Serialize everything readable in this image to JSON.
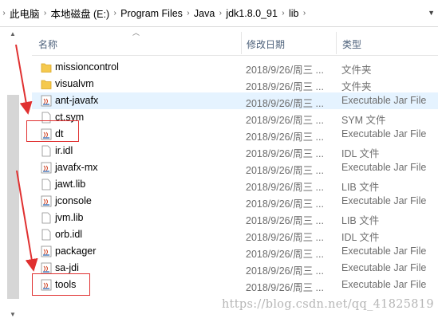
{
  "breadcrumb": {
    "segments": [
      "此电脑",
      "本地磁盘 (E:)",
      "Program Files",
      "Java",
      "jdk1.8.0_91",
      "lib"
    ]
  },
  "columns": {
    "name": "名称",
    "date": "修改日期",
    "type": "类型"
  },
  "files": [
    {
      "name": "missioncontrol",
      "date": "2018/9/26/周三 ...",
      "type": "文件夹",
      "icon": "folder-icon"
    },
    {
      "name": "visualvm",
      "date": "2018/9/26/周三 ...",
      "type": "文件夹",
      "icon": "folder-icon"
    },
    {
      "name": "ant-javafx",
      "date": "2018/9/26/周三 ...",
      "type": "Executable Jar File",
      "icon": "jar-icon"
    },
    {
      "name": "ct.sym",
      "date": "2018/9/26/周三 ...",
      "type": "SYM 文件",
      "icon": "file-icon"
    },
    {
      "name": "dt",
      "date": "2018/9/26/周三 ...",
      "type": "Executable Jar File",
      "icon": "jar-icon"
    },
    {
      "name": "ir.idl",
      "date": "2018/9/26/周三 ...",
      "type": "IDL 文件",
      "icon": "file-icon"
    },
    {
      "name": "javafx-mx",
      "date": "2018/9/26/周三 ...",
      "type": "Executable Jar File",
      "icon": "jar-icon"
    },
    {
      "name": "jawt.lib",
      "date": "2018/9/26/周三 ...",
      "type": "LIB 文件",
      "icon": "file-icon"
    },
    {
      "name": "jconsole",
      "date": "2018/9/26/周三 ...",
      "type": "Executable Jar File",
      "icon": "jar-icon"
    },
    {
      "name": "jvm.lib",
      "date": "2018/9/26/周三 ...",
      "type": "LIB 文件",
      "icon": "file-icon"
    },
    {
      "name": "orb.idl",
      "date": "2018/9/26/周三 ...",
      "type": "IDL 文件",
      "icon": "file-icon"
    },
    {
      "name": "packager",
      "date": "2018/9/26/周三 ...",
      "type": "Executable Jar File",
      "icon": "jar-icon"
    },
    {
      "name": "sa-jdi",
      "date": "2018/9/26/周三 ...",
      "type": "Executable Jar File",
      "icon": "jar-icon"
    },
    {
      "name": "tools",
      "date": "2018/9/26/周三 ...",
      "type": "Executable Jar File",
      "icon": "jar-icon"
    }
  ],
  "watermark": "https://blog.csdn.net/qq_41825819",
  "colors": {
    "selected_row": "#e5f3ff",
    "annotation_red": "#e03030",
    "header_text": "#4c607a"
  }
}
